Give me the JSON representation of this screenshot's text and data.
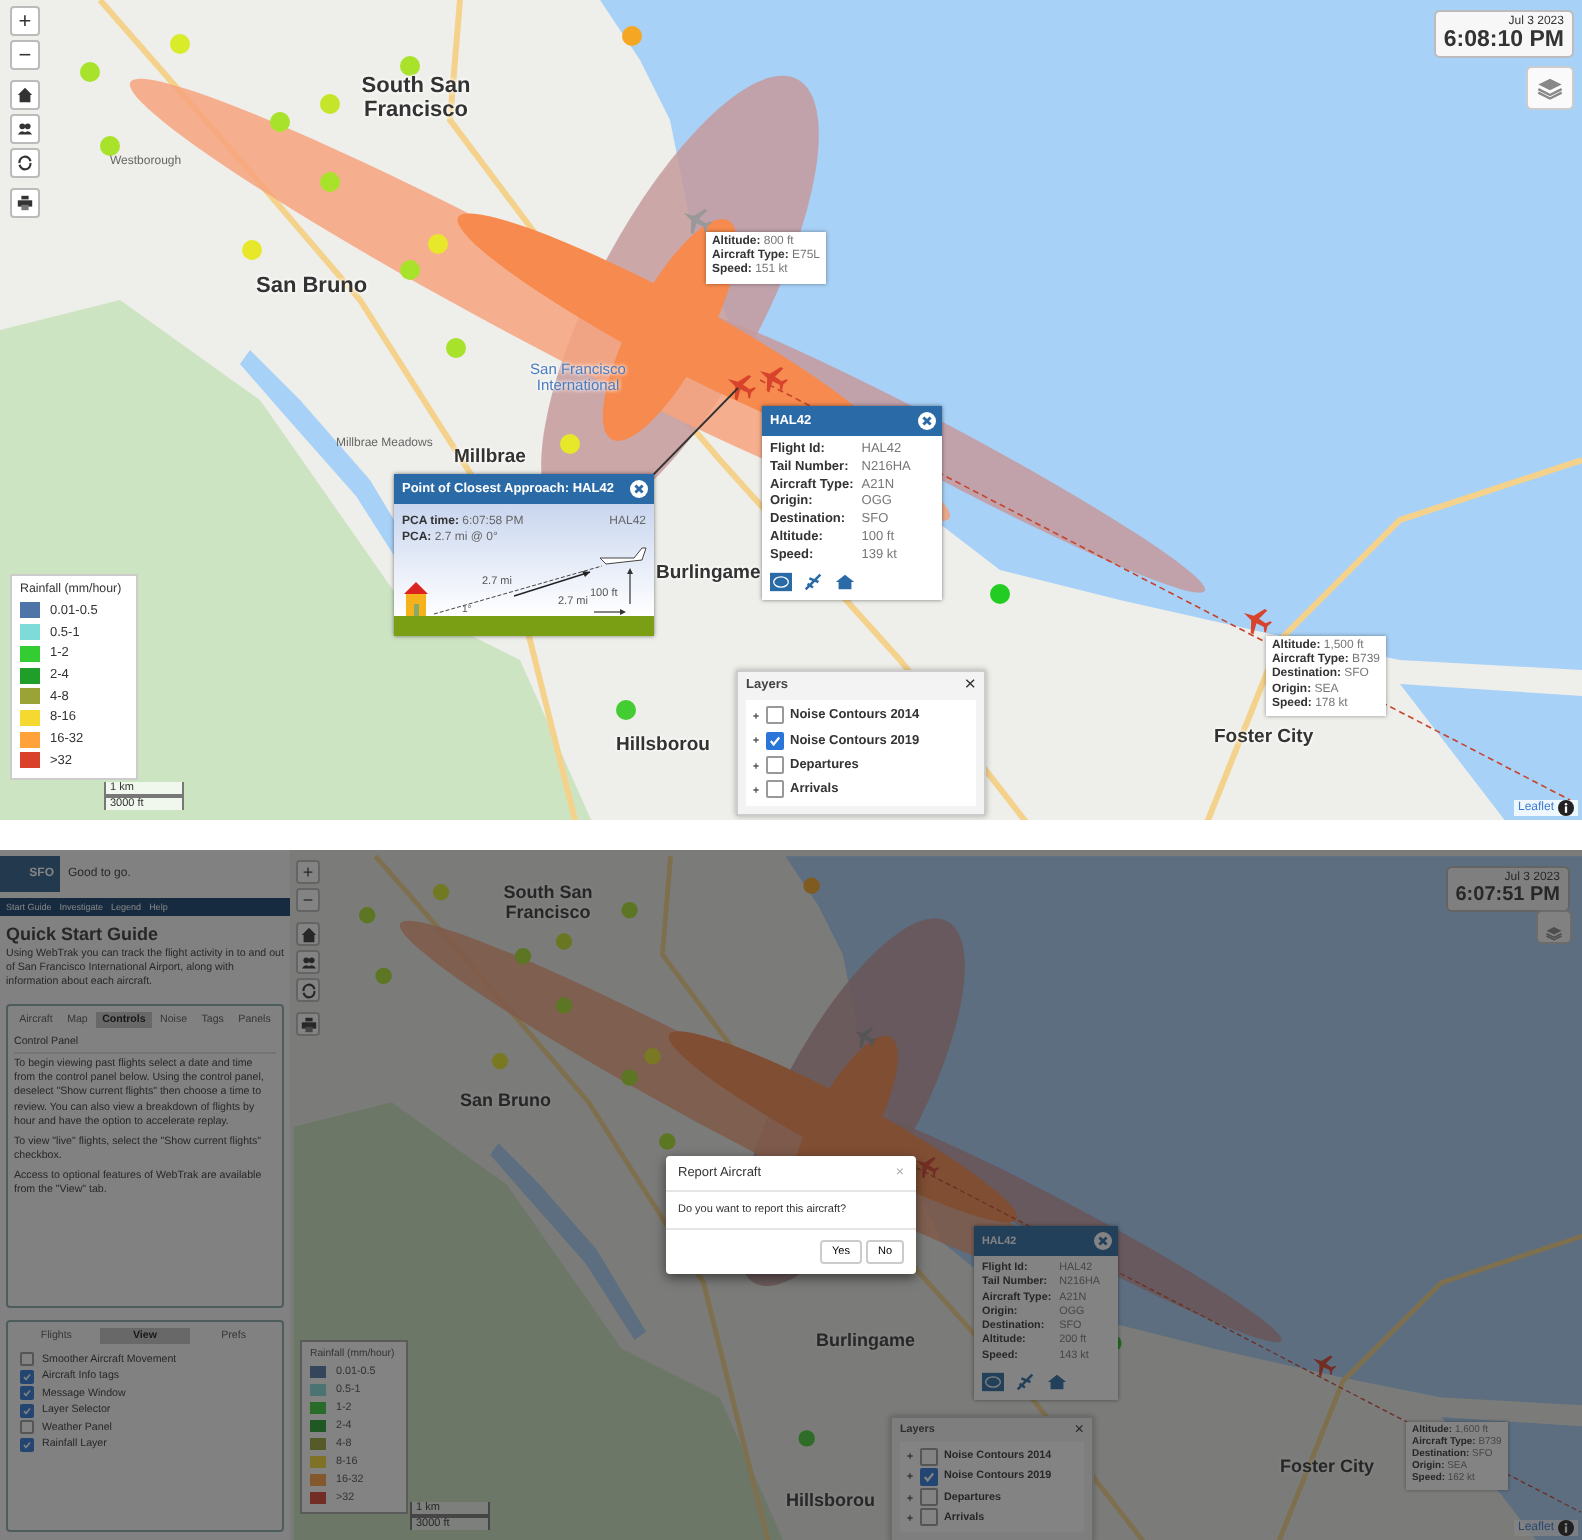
{
  "top_map": {
    "zoom_controls": [
      "+",
      "−"
    ],
    "clock": {
      "date": "Jul 3 2023",
      "time": "6:08:10 PM"
    },
    "place_labels": [
      {
        "text": "South San Francisco",
        "kind": "city"
      },
      {
        "text": "San Bruno",
        "kind": "city"
      },
      {
        "text": "Millbrae",
        "kind": "city"
      },
      {
        "text": "Burlingame",
        "kind": "city"
      },
      {
        "text": "Hillsborou",
        "kind": "city"
      },
      {
        "text": "Foster City",
        "kind": "city"
      },
      {
        "text": "San Francisco International",
        "kind": "airport"
      },
      {
        "text": "Westborough",
        "kind": "street"
      },
      {
        "text": "Millbrae Meadows",
        "kind": "street"
      }
    ],
    "pca_popup": {
      "title": "Point of Closest Approach: HAL42",
      "time_label": "PCA time:",
      "time": "6:07:58 PM",
      "pca_label": "PCA:",
      "pca": "2.7 mi @ 0°",
      "flight": "HAL42",
      "slant_distance": "2.7 mi",
      "altitude": "100 ft",
      "angle": "1°",
      "ground_distance": "2.7 mi"
    },
    "flight_popup": {
      "title": "HAL42",
      "rows": [
        {
          "label": "Flight Id:",
          "value": "HAL42"
        },
        {
          "label": "Tail Number:",
          "value": "N216HA"
        },
        {
          "label": "Aircraft Type:",
          "value": "A21N"
        },
        {
          "label": "Origin:",
          "value": "OGG"
        },
        {
          "label": "Destination:",
          "value": "SFO"
        },
        {
          "label": "Altitude:",
          "value": "100 ft"
        },
        {
          "label": "Speed:",
          "value": "139 kt"
        }
      ]
    },
    "aircraft_tags": [
      {
        "rows": [
          {
            "label": "Altitude:",
            "value": "800 ft"
          },
          {
            "label": "Aircraft Type:",
            "value": "E75L"
          },
          {
            "label": "Speed:",
            "value": "151 kt"
          }
        ]
      },
      {
        "rows": [
          {
            "label": "Altitude:",
            "value": "1,500 ft"
          },
          {
            "label": "Aircraft Type:",
            "value": "B739"
          },
          {
            "label": "Destination:",
            "value": "SFO"
          },
          {
            "label": "Origin:",
            "value": "SEA"
          },
          {
            "label": "Speed:",
            "value": "178 kt"
          }
        ]
      }
    ],
    "layers": {
      "title": "Layers",
      "close": "×",
      "items": [
        {
          "label": "Noise Contours 2014",
          "checked": false
        },
        {
          "label": "Noise Contours 2019",
          "checked": true
        },
        {
          "label": "Departures",
          "checked": false
        },
        {
          "label": "Arrivals",
          "checked": false
        }
      ]
    },
    "legend": {
      "title": "Rainfall (mm/hour)",
      "items": [
        {
          "label": "0.01-0.5",
          "color": "#4f74a8"
        },
        {
          "label": "0.5-1",
          "color": "#7fdbd8"
        },
        {
          "label": "1-2",
          "color": "#33cc33"
        },
        {
          "label": "2-4",
          "color": "#1f9e2a"
        },
        {
          "label": "4-8",
          "color": "#9aa336"
        },
        {
          "label": "8-16",
          "color": "#f5d931"
        },
        {
          "label": "16-32",
          "color": "#ffa23a"
        },
        {
          "label": ">32",
          "color": "#d9412b"
        }
      ]
    },
    "scale": {
      "metric": "1 km",
      "imperial": "3000 ft"
    },
    "attribution": "Leaflet"
  },
  "bottom_app": {
    "sidebar": {
      "logo": "SFO",
      "status": "Good to go.",
      "nav": [
        "Start Guide",
        "Investigate",
        "Legend",
        "Help"
      ],
      "heading": "Quick Start Guide",
      "intro": "Using WebTrak you can track the flight activity in to and out of San Francisco International Airport, along with information about each aircraft.",
      "tabs": [
        {
          "label": "Aircraft",
          "selected": false
        },
        {
          "label": "Map",
          "selected": false
        },
        {
          "label": "Controls",
          "selected": true
        },
        {
          "label": "Noise",
          "selected": false
        },
        {
          "label": "Tags",
          "selected": false
        },
        {
          "label": "Panels",
          "selected": false
        }
      ],
      "section_title": "Control Panel",
      "paragraphs": [
        "To begin viewing past flights select a date and time from the control panel below. Using the control panel, deselect \"Show current flights\" then choose a time to review. You can also view a breakdown of flights by hour and have the option to accelerate replay.",
        "To view \"live\" flights, select the \"Show current flights\" checkbox.",
        "Access to optional features of WebTrak are available from the \"View\" tab."
      ],
      "view_tabs": [
        {
          "label": "Flights",
          "selected": false
        },
        {
          "label": "View",
          "selected": true
        },
        {
          "label": "Prefs",
          "selected": false
        }
      ],
      "options": [
        {
          "label": "Smoother Aircraft Movement",
          "checked": false
        },
        {
          "label": "Aircraft Info tags",
          "checked": true
        },
        {
          "label": "Message Window",
          "checked": true
        },
        {
          "label": "Layer Selector",
          "checked": true
        },
        {
          "label": "Weather Panel",
          "checked": false
        },
        {
          "label": "Rainfall Layer",
          "checked": true
        }
      ]
    },
    "map": {
      "zoom_controls": [
        "+",
        "−"
      ],
      "clock": {
        "date": "Jul 3 2023",
        "time": "6:07:51 PM"
      },
      "place_labels": [
        {
          "text": "South San Francisco",
          "kind": "city"
        },
        {
          "text": "San Bruno",
          "kind": "city"
        },
        {
          "text": "Burlingame",
          "kind": "city"
        },
        {
          "text": "Hillsborou",
          "kind": "city"
        },
        {
          "text": "Foster City",
          "kind": "city"
        }
      ],
      "flight_popup": {
        "title": "HAL42",
        "rows": [
          {
            "label": "Flight Id:",
            "value": "HAL42"
          },
          {
            "label": "Tail Number:",
            "value": "N216HA"
          },
          {
            "label": "Aircraft Type:",
            "value": "A21N"
          },
          {
            "label": "Origin:",
            "value": "OGG"
          },
          {
            "label": "Destination:",
            "value": "SFO"
          },
          {
            "label": "Altitude:",
            "value": "200 ft"
          },
          {
            "label": "Speed:",
            "value": "143 kt"
          }
        ]
      },
      "aircraft_tags": [
        {
          "rows": [
            {
              "label": "Altitude:",
              "value": "1,600 ft"
            },
            {
              "label": "Aircraft Type:",
              "value": "B739"
            },
            {
              "label": "Destination:",
              "value": "SFO"
            },
            {
              "label": "Origin:",
              "value": "SEA"
            },
            {
              "label": "Speed:",
              "value": "162 kt"
            }
          ]
        }
      ],
      "layers": {
        "title": "Layers",
        "close": "×",
        "items": [
          {
            "label": "Noise Contours 2014",
            "checked": false
          },
          {
            "label": "Noise Contours 2019",
            "checked": true
          },
          {
            "label": "Departures",
            "checked": false
          },
          {
            "label": "Arrivals",
            "checked": false
          }
        ]
      },
      "legend": {
        "title": "Rainfall (mm/hour)",
        "items": [
          {
            "label": "0.01-0.5",
            "color": "#34455c"
          },
          {
            "label": "0.5-1",
            "color": "#4a7372"
          },
          {
            "label": "1-2",
            "color": "#286c28"
          },
          {
            "label": "2-4",
            "color": "#1f5823"
          },
          {
            "label": "4-8",
            "color": "#565a29"
          },
          {
            "label": "8-16",
            "color": "#7f7227"
          },
          {
            "label": "16-32",
            "color": "#83592b"
          },
          {
            "label": ">32",
            "color": "#722e24"
          }
        ]
      },
      "scale": {
        "metric": "1 km",
        "imperial": "3000 ft"
      },
      "attribution": "Leaflet"
    },
    "dialog": {
      "title": "Report Aircraft",
      "close": "×",
      "message": "Do you want to report this aircraft?",
      "buttons": [
        "Yes",
        "No"
      ]
    }
  }
}
